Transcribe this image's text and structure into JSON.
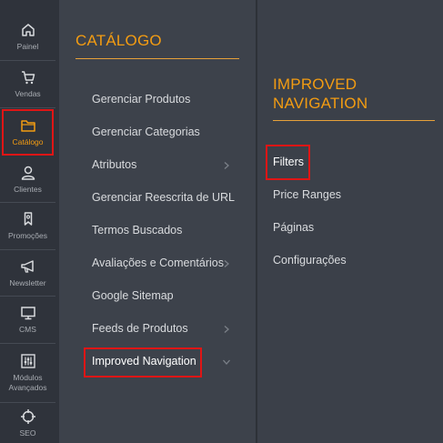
{
  "sidebar": {
    "items": [
      {
        "label": "Painel",
        "icon": "home-icon"
      },
      {
        "label": "Vendas",
        "icon": "cart-icon"
      },
      {
        "label": "Catálogo",
        "icon": "folder-icon",
        "active": true
      },
      {
        "label": "Clientes",
        "icon": "user-icon"
      },
      {
        "label": "Promoções",
        "icon": "tag-icon"
      },
      {
        "label": "Newsletter",
        "icon": "megaphone-icon"
      },
      {
        "label": "CMS",
        "icon": "monitor-icon"
      },
      {
        "label": "Módulos Avançados",
        "icon": "sliders-icon"
      },
      {
        "label": "SEO",
        "icon": "crosshair-icon"
      }
    ]
  },
  "catalog_menu": {
    "title": "CATÁLOGO",
    "items": [
      {
        "label": "Gerenciar Produtos"
      },
      {
        "label": "Gerenciar Categorias"
      },
      {
        "label": "Atributos",
        "has_submenu": true
      },
      {
        "label": "Gerenciar Reescrita de URL"
      },
      {
        "label": "Termos Buscados"
      },
      {
        "label": "Avaliações e Comentários",
        "has_submenu": true
      },
      {
        "label": "Google Sitemap"
      },
      {
        "label": "Feeds de Produtos",
        "has_submenu": true
      },
      {
        "label": "Improved Navigation",
        "has_submenu": true,
        "expanded": true
      }
    ]
  },
  "submenu": {
    "title_line1": "IMPROVED",
    "title_line2": "NAVIGATION",
    "items": [
      {
        "label": "Filters"
      },
      {
        "label": "Price Ranges"
      },
      {
        "label": "Páginas"
      },
      {
        "label": "Configurações"
      }
    ]
  },
  "colors": {
    "accent": "#f39c12",
    "highlight": "#e01515",
    "rail_bg": "#2f333b",
    "panel_bg": "#3d424b"
  }
}
